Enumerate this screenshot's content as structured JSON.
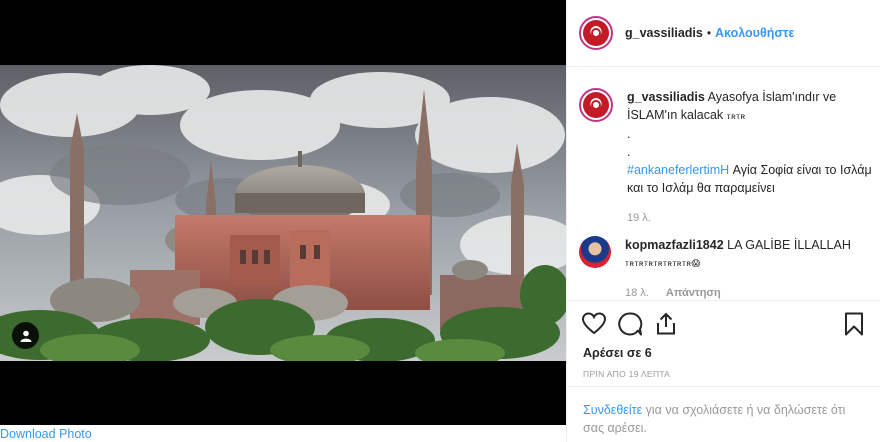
{
  "post": {
    "download_label": "Download Photo"
  },
  "header": {
    "username": "g_vassiliadis",
    "separator": "•",
    "follow_label": "Ακολουθήστε"
  },
  "caption": {
    "username": "g_vassiliadis",
    "text": "Ayasofya İslam'ındır ve İSLAM'ın kalacak",
    "suffix": "ᴛʀᴛʀ",
    "dot1": ".",
    "dot2": ".",
    "hashtag": "#ankaneferlertimH",
    "text2": "Αγία Σοφία είναι το Ισλάμ και το Ισλάμ θα παραμείνει",
    "age": "19 λ."
  },
  "comments": [
    {
      "username": "kopmazfazli1842",
      "text": "LA GALİBE İLLALLAH",
      "suffix": "ᴛʀᴛʀᴛʀᴛʀᴛʀᴛʀᴛʀ😱",
      "age": "18 λ.",
      "reply_label": "Απάντηση"
    }
  ],
  "actions": {
    "icons": [
      "heart-icon",
      "comment-icon",
      "share-icon",
      "bookmark-icon"
    ],
    "likes": "Αρέσει σε 6",
    "timestamp": "ΠΡΙΝ ΑΠΟ 19 ΛΕΠΤΑ",
    "login_link": "Συνδεθείτε",
    "login_text": "για να σχολιάσετε ή να δηλώσετε ότι σας αρέσει."
  },
  "colors": {
    "link": "#3897f0",
    "text": "#262626",
    "muted": "#999999",
    "border": "#efefef"
  }
}
